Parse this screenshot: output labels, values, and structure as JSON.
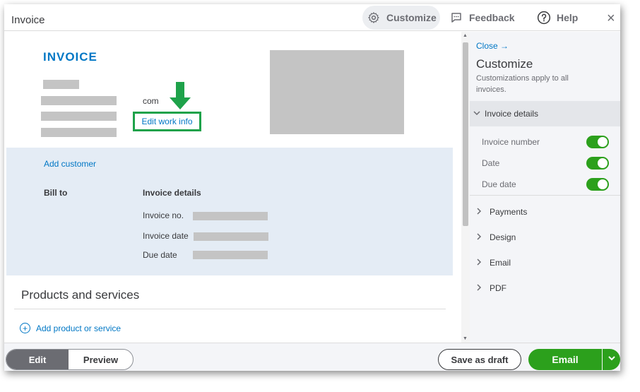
{
  "header": {
    "title": "Invoice",
    "customize_label": "Customize",
    "feedback_label": "Feedback",
    "help_label": "Help",
    "close_glyph": "×"
  },
  "invoice": {
    "heading": "INVOICE",
    "email_suffix": "com",
    "edit_work_info": "Edit work info",
    "add_customer": "Add customer",
    "bill_to": "Bill to",
    "details_heading": "Invoice details",
    "fields": {
      "invoice_no": "Invoice no.",
      "invoice_date": "Invoice date",
      "due_date": "Due date"
    },
    "products_heading": "Products and services",
    "add_product": "Add product or service"
  },
  "customize_panel": {
    "close_label": "Close →",
    "title": "Customize",
    "subtitle": "Customizations apply to all invoices.",
    "active_section": "Invoice details",
    "toggles": [
      {
        "label": "Invoice number",
        "on": true
      },
      {
        "label": "Date",
        "on": true
      },
      {
        "label": "Due date",
        "on": true
      }
    ],
    "sections": [
      "Payments",
      "Design",
      "Email",
      "PDF"
    ]
  },
  "footer": {
    "edit_label": "Edit",
    "preview_label": "Preview",
    "save_draft_label": "Save as draft",
    "email_label": "Email"
  },
  "colors": {
    "accent_blue": "#0077c5",
    "brand_green": "#2ca01c",
    "highlight_green": "#1ea24a",
    "panel_blue": "#e4ecf5"
  }
}
